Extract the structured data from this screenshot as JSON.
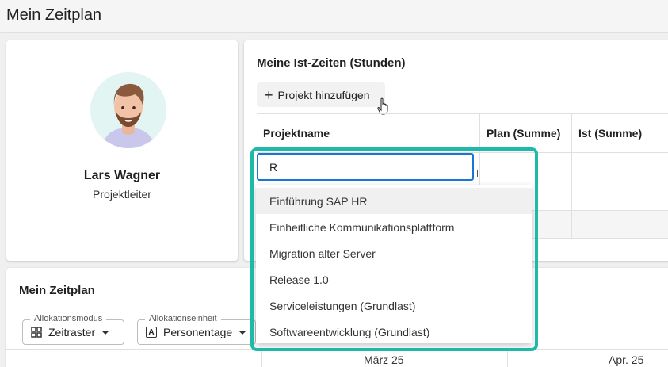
{
  "header": {
    "title": "Mein Zeitplan"
  },
  "profile": {
    "name": "Lars Wagner",
    "role": "Projektleiter"
  },
  "times": {
    "title": "Meine Ist-Zeiten (Stunden)",
    "add_label": "Projekt hinzufügen",
    "columns": {
      "name": "Projektname",
      "plan": "Plan (Summe)",
      "ist": "Ist (Summe)"
    }
  },
  "search": {
    "value": "R"
  },
  "dropdown": {
    "options": [
      "Einführung SAP HR",
      "Einheitliche Kommunikationsplattform",
      "Migration alter Server",
      "Release 1.0",
      "Serviceleistungen (Grundlast)",
      "Softwareentwicklung (Grundlast)"
    ]
  },
  "schedule": {
    "title": "Mein Zeitplan",
    "mode": {
      "label": "Allokationsmodus",
      "value": "Zeitraster"
    },
    "unit": {
      "label": "Allokationseinheit",
      "value": "Personentage"
    },
    "months": [
      "März 25",
      "Apr. 25"
    ]
  },
  "colors": {
    "highlight": "#1fb9a8",
    "focus": "#1976d2"
  }
}
